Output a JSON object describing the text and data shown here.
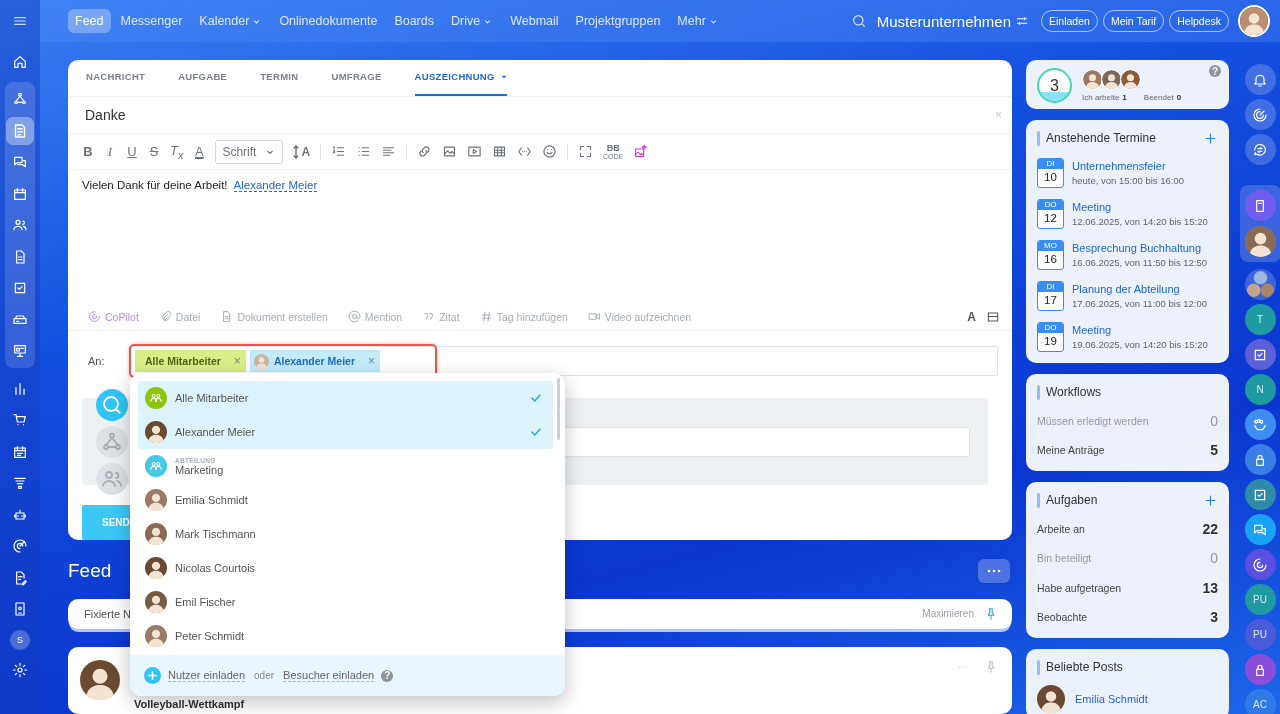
{
  "topbar": {
    "nav": [
      {
        "label": "Feed",
        "selected": true,
        "has_caret": false
      },
      {
        "label": "Messenger",
        "selected": false,
        "has_caret": false
      },
      {
        "label": "Kalender",
        "selected": false,
        "has_caret": true
      },
      {
        "label": "Onlinedokumente",
        "selected": false,
        "has_caret": false
      },
      {
        "label": "Boards",
        "selected": false,
        "has_caret": false
      },
      {
        "label": "Drive",
        "selected": false,
        "has_caret": true
      },
      {
        "label": "Webmail",
        "selected": false,
        "has_caret": false
      },
      {
        "label": "Projektgruppen",
        "selected": false,
        "has_caret": false
      },
      {
        "label": "Mehr",
        "selected": false,
        "has_caret": true
      }
    ],
    "company": "Musterunternehmen",
    "buttons": [
      "Einladen",
      "Mein Tarif",
      "Helpdesk"
    ]
  },
  "left_rail": {
    "top": [
      {
        "selected": false
      }
    ],
    "pinned": [
      {
        "selected": false
      },
      {
        "selected": true
      },
      {
        "selected": false
      },
      {
        "selected": false
      },
      {
        "selected": false
      },
      {
        "selected": false
      },
      {
        "selected": false
      },
      {
        "selected": false
      },
      {
        "selected": false
      }
    ],
    "rest": [
      {
        "kind": "icon",
        "selected": false
      },
      {
        "kind": "icon",
        "selected": false
      },
      {
        "kind": "icon",
        "selected": false
      },
      {
        "kind": "icon",
        "selected": false
      },
      {
        "kind": "icon",
        "selected": false
      },
      {
        "kind": "icon",
        "selected": false
      },
      {
        "kind": "icon",
        "selected": false
      },
      {
        "kind": "icon",
        "selected": false
      },
      {
        "kind": "letter",
        "text": "S",
        "selected": false
      },
      {
        "kind": "icon",
        "selected": false
      }
    ]
  },
  "composer": {
    "tabs": [
      {
        "label": "NACHRICHT",
        "selected": false,
        "has_caret": false
      },
      {
        "label": "AUFGABE",
        "selected": false,
        "has_caret": false
      },
      {
        "label": "TERMIN",
        "selected": false,
        "has_caret": false
      },
      {
        "label": "UMFRAGE",
        "selected": false,
        "has_caret": false
      },
      {
        "label": "AUSZEICHNUNG",
        "selected": true,
        "has_caret": true
      }
    ],
    "title": "Danke",
    "title_close": "×",
    "format_buttons": [
      {
        "label": "B",
        "kind": "bold"
      },
      {
        "label": "I",
        "kind": "italic"
      },
      {
        "label": "U",
        "kind": "underline"
      },
      {
        "label": "S",
        "kind": "strike"
      },
      {
        "label": "T$_{x}$",
        "kind": "clear"
      },
      {
        "label": "A",
        "kind": "color"
      }
    ],
    "font_select": "Schrift",
    "size_button": "A",
    "bbcode_label": "BB",
    "bbcode_caption": "CODE",
    "body_text": "Vielen Dank für deine Arbeit!",
    "mention": "Alexander Meier",
    "actions": [
      {
        "label": "CoPilot",
        "kind": "copilot"
      },
      {
        "label": "Datei",
        "kind": "file"
      },
      {
        "label": "Dokument erstellen",
        "kind": "document"
      },
      {
        "label": "Mention",
        "kind": "mention"
      },
      {
        "label": "Zitat",
        "kind": "quote"
      },
      {
        "label": "Tag hinzufügen",
        "kind": "tag"
      },
      {
        "label": "Video aufzeichnen",
        "kind": "video"
      }
    ],
    "text_style_button": "A",
    "recipients_label": "An:",
    "chips": [
      {
        "label": "Alle Mitarbeiter",
        "kind": "group",
        "remove": "×"
      },
      {
        "label": "Alexander Meier",
        "kind": "user",
        "remove": "×"
      }
    ],
    "send_button": "SEND"
  },
  "recipient_dropdown": {
    "items": [
      {
        "name": "Alle Mitarbeiter",
        "kind": "group",
        "selected": true
      },
      {
        "name": "Alexander Meier",
        "kind": "user",
        "selected": true
      },
      {
        "name": "Marketing",
        "caption": "ABTEILUNG",
        "kind": "department",
        "selected": false
      },
      {
        "name": "Emilia Schmidt",
        "kind": "user",
        "selected": false
      },
      {
        "name": "Mark Tischmann",
        "kind": "user",
        "selected": false
      },
      {
        "name": "Nicolas Courtois",
        "kind": "user",
        "selected": false
      },
      {
        "name": "Emil Fischer",
        "kind": "user",
        "selected": false
      },
      {
        "name": "Peter Schmidt",
        "kind": "user",
        "selected": false
      }
    ],
    "invite_users": "Nutzer einladen",
    "or": "oder",
    "invite_visitors": "Besucher einladen",
    "help": "?"
  },
  "feed": {
    "title": "Feed",
    "pinned_label": "Fixierte N",
    "maximize": "Maximieren",
    "post_title": "Volleyball-Wettkampf"
  },
  "task_counter": {
    "count": "3",
    "working_label": "Ich arbeite",
    "working": "1",
    "done_label": "Beendet",
    "done": "0",
    "help": "?"
  },
  "events": {
    "title": "Anstehende Termine",
    "items": [
      {
        "weekday": "DI",
        "day": "10",
        "title": "Unternehmensfeier",
        "time": "heute, von 15:00 bis 16:00"
      },
      {
        "weekday": "DO",
        "day": "12",
        "title": "Meeting",
        "time": "12.06.2025, von 14:20 bis 15:20"
      },
      {
        "weekday": "MO",
        "day": "16",
        "title": "Besprechung Buchhaltung",
        "time": "16.06.2025, von 11:50 bis 12:50"
      },
      {
        "weekday": "DI",
        "day": "17",
        "title": "Planung der Abteilung",
        "time": "17.06.2025, von 11:00 bis 12:00"
      },
      {
        "weekday": "DO",
        "day": "19",
        "title": "Meeting",
        "time": "19.06.2025, von 14:20 bis 15:20"
      }
    ]
  },
  "workflows": {
    "title": "Workflows",
    "rows": [
      {
        "label": "Müssen erledigt werden",
        "value": "0",
        "muted": true
      },
      {
        "label": "Meine Anträge",
        "value": "5",
        "muted": false
      }
    ]
  },
  "tasks": {
    "title": "Aufgaben",
    "rows": [
      {
        "label": "Arbeite an",
        "value": "22",
        "muted": false
      },
      {
        "label": "Bin beteiligt",
        "value": "0",
        "muted": true
      },
      {
        "label": "Habe aufgetragen",
        "value": "13",
        "muted": false
      },
      {
        "label": "Beobachte",
        "value": "3",
        "muted": false
      }
    ]
  },
  "popular_posts": {
    "title": "Beliebte Posts",
    "author": "Emilia Schmidt"
  },
  "right_rail": {
    "top": [
      {
        "kind": "icon"
      },
      {
        "kind": "icon"
      },
      {
        "kind": "icon"
      }
    ],
    "pinned": [
      {
        "kind": "icon",
        "color": "#6f5cf0"
      },
      {
        "kind": "avatar"
      }
    ],
    "rest": [
      {
        "kind": "avatar-group"
      },
      {
        "kind": "letter",
        "text": "T",
        "color": "#1f9aa0"
      },
      {
        "kind": "icon",
        "color": "#5d5fd8"
      },
      {
        "kind": "letter",
        "text": "N",
        "color": "#1f9aa0"
      },
      {
        "kind": "icon",
        "color": "#3f8cf2"
      },
      {
        "kind": "icon",
        "color": "#3a7fe6"
      },
      {
        "kind": "icon",
        "color": "#2f8aa8"
      },
      {
        "kind": "icon",
        "color": "#1aa3f2"
      },
      {
        "kind": "icon",
        "color": "#5a4fe0"
      },
      {
        "kind": "letter",
        "text": "PU",
        "color": "#1f9aa0"
      },
      {
        "kind": "letter",
        "text": "PU",
        "color": "#4a5ad8"
      },
      {
        "kind": "icon",
        "color": "#8a4fd8"
      },
      {
        "kind": "letter",
        "text": "AC",
        "color": "#2f7ae8"
      }
    ]
  }
}
